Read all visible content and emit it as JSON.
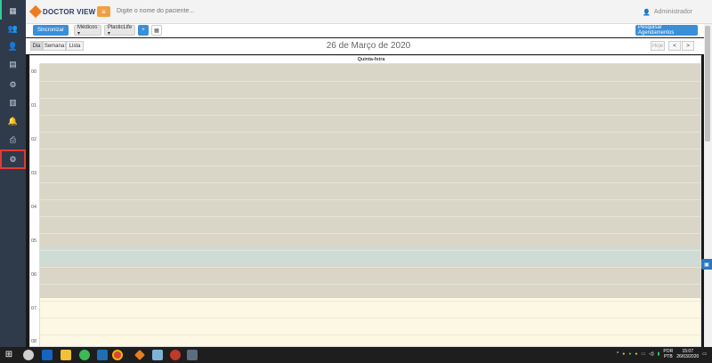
{
  "app": {
    "logo_text": "DOCTOR VIEW",
    "search_placeholder": "Digite o nome do paciente...",
    "user_name": "Administrador"
  },
  "sidebar": {
    "items": [
      {
        "icon": "calendar-icon"
      },
      {
        "icon": "users-icon"
      },
      {
        "icon": "user-add-icon"
      },
      {
        "icon": "report-icon"
      },
      {
        "icon": "settings-icon"
      },
      {
        "icon": "building-icon"
      },
      {
        "icon": "bell-icon"
      },
      {
        "icon": "print-icon"
      },
      {
        "icon": "gears-icon",
        "active": true
      }
    ]
  },
  "toolbar": {
    "sync_label": "Sincronizar",
    "doctors_label": "Médicos ▾",
    "clinic_label": "PlasticLife ▾",
    "add_label": "+",
    "calendar_label": "▦",
    "search_appointments_label": "Pesquisar Agendamentos"
  },
  "calendar": {
    "views": [
      "Dia",
      "Semana",
      "Lista"
    ],
    "active_view": "Dia",
    "title": "26 de Março de 2020",
    "today_label": "Hoje",
    "prev_label": "<",
    "next_label": ">",
    "day_header": "Quinta-feira",
    "hours": [
      "00",
      "01",
      "02",
      "03",
      "04",
      "05",
      "06",
      "07",
      "08"
    ],
    "colors": {
      "closed": "#d9d6c7",
      "highlight": "#cfdcd6",
      "open": "#fcf8e3"
    }
  },
  "taskbar": {
    "lang": "POR",
    "lang2": "PTB",
    "time": "15:07",
    "date": "26/03/2020"
  }
}
